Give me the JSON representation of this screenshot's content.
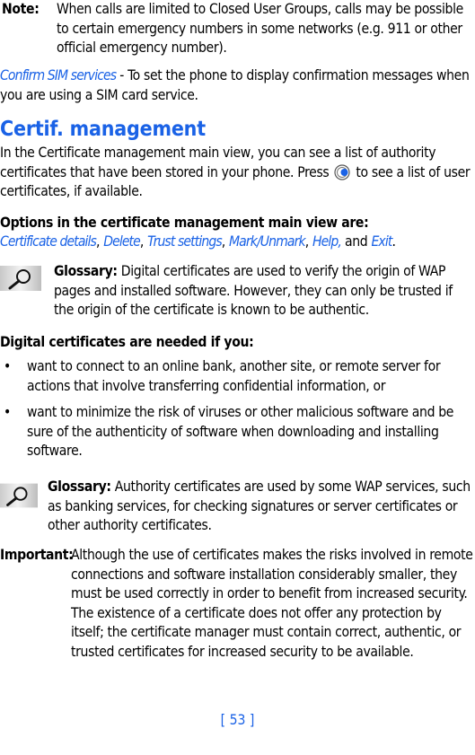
{
  "note": {
    "label": "Note:",
    "text": "When calls are limited to Closed User Groups, calls may be possible to certain emergency numbers in some networks (e.g. 911 or other official emergency number)."
  },
  "confirm_sim": {
    "link": "Confirm SIM services",
    "text": " - To set the phone to display confirmation messages when you are using a SIM card service."
  },
  "section": {
    "heading": "Certif. management",
    "intro_before": "In the Certificate management main view, you can see a list of authority certificates that have been stored in your phone. Press",
    "intro_icon": "navigation-key-right-icon",
    "intro_after": "to see a list of user certificates, if available.",
    "options_title": "Options in the certificate management main view are:",
    "options": [
      "Certificate details",
      "Delete",
      "Trust settings",
      "Mark/Unmark",
      "Help,"
    ],
    "options_and": "and",
    "options_last": "Exit",
    "options_end": "."
  },
  "glossary1": {
    "icon": "magnifier-icon",
    "label": "Glossary:",
    "text": " Digital certificates are used to verify the origin of WAP pages and installed software. However, they can only be trusted if the origin of the certificate is known to be authentic."
  },
  "needed": {
    "title": "Digital certificates are needed if you:",
    "bullet": "•",
    "items": [
      "want to connect to an online bank, another site, or remote server for actions that involve transferring confidential information, or",
      "want to minimize the risk of viruses or other malicious software and be sure of the authenticity of software when downloading and installing software."
    ]
  },
  "glossary2": {
    "icon": "magnifier-icon",
    "label": "Glossary:",
    "text": " Authority certificates are used by some WAP services, such as banking services, for checking signatures or server certificates or other authority certificates."
  },
  "important": {
    "label": "Important:",
    "text": "Although the use of certificates makes the risks involved in remote connections and software installation considerably smaller, they must be used correctly in order to benefit from increased security. The existence of a certificate does not offer any protection by itself; the certificate manager must contain correct, authentic, or trusted certificates for increased security to be available."
  },
  "footer": {
    "page_number": "[ 53 ]"
  },
  "colors": {
    "accent": "#1a62e6",
    "text": "#000000"
  }
}
